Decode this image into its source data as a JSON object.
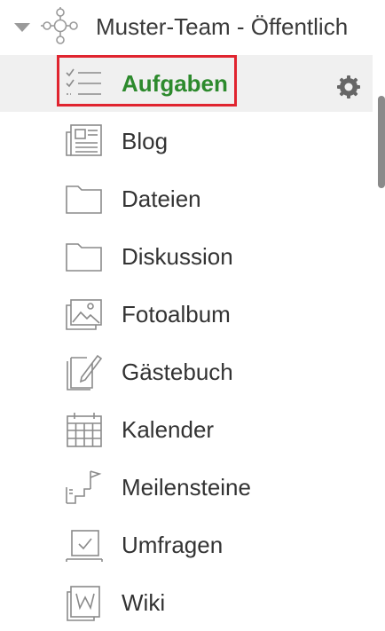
{
  "tree": {
    "team": {
      "label": "Muster-Team - Öffentlich",
      "expand_icon": "caret-down-icon",
      "icon": "team-network-icon"
    },
    "items": [
      {
        "label": "Aufgaben",
        "icon": "tasks-checklist-icon",
        "active": true,
        "settings_icon": "gear-icon"
      },
      {
        "label": "Blog",
        "icon": "newspaper-icon"
      },
      {
        "label": "Dateien",
        "icon": "folder-icon"
      },
      {
        "label": "Diskussion",
        "icon": "folder-icon"
      },
      {
        "label": "Fotoalbum",
        "icon": "photo-icon"
      },
      {
        "label": "Gästebuch",
        "icon": "guestbook-pencil-icon"
      },
      {
        "label": "Kalender",
        "icon": "calendar-icon"
      },
      {
        "label": "Meilensteine",
        "icon": "milestones-flag-icon"
      },
      {
        "label": "Umfragen",
        "icon": "poll-checkbox-icon"
      },
      {
        "label": "Wiki",
        "icon": "wiki-book-icon"
      }
    ]
  },
  "colors": {
    "active_text": "#2d8a2d",
    "active_background": "#f0f0f0",
    "focus_border": "#e0242f",
    "icon_gray": "#8a8a8a"
  }
}
